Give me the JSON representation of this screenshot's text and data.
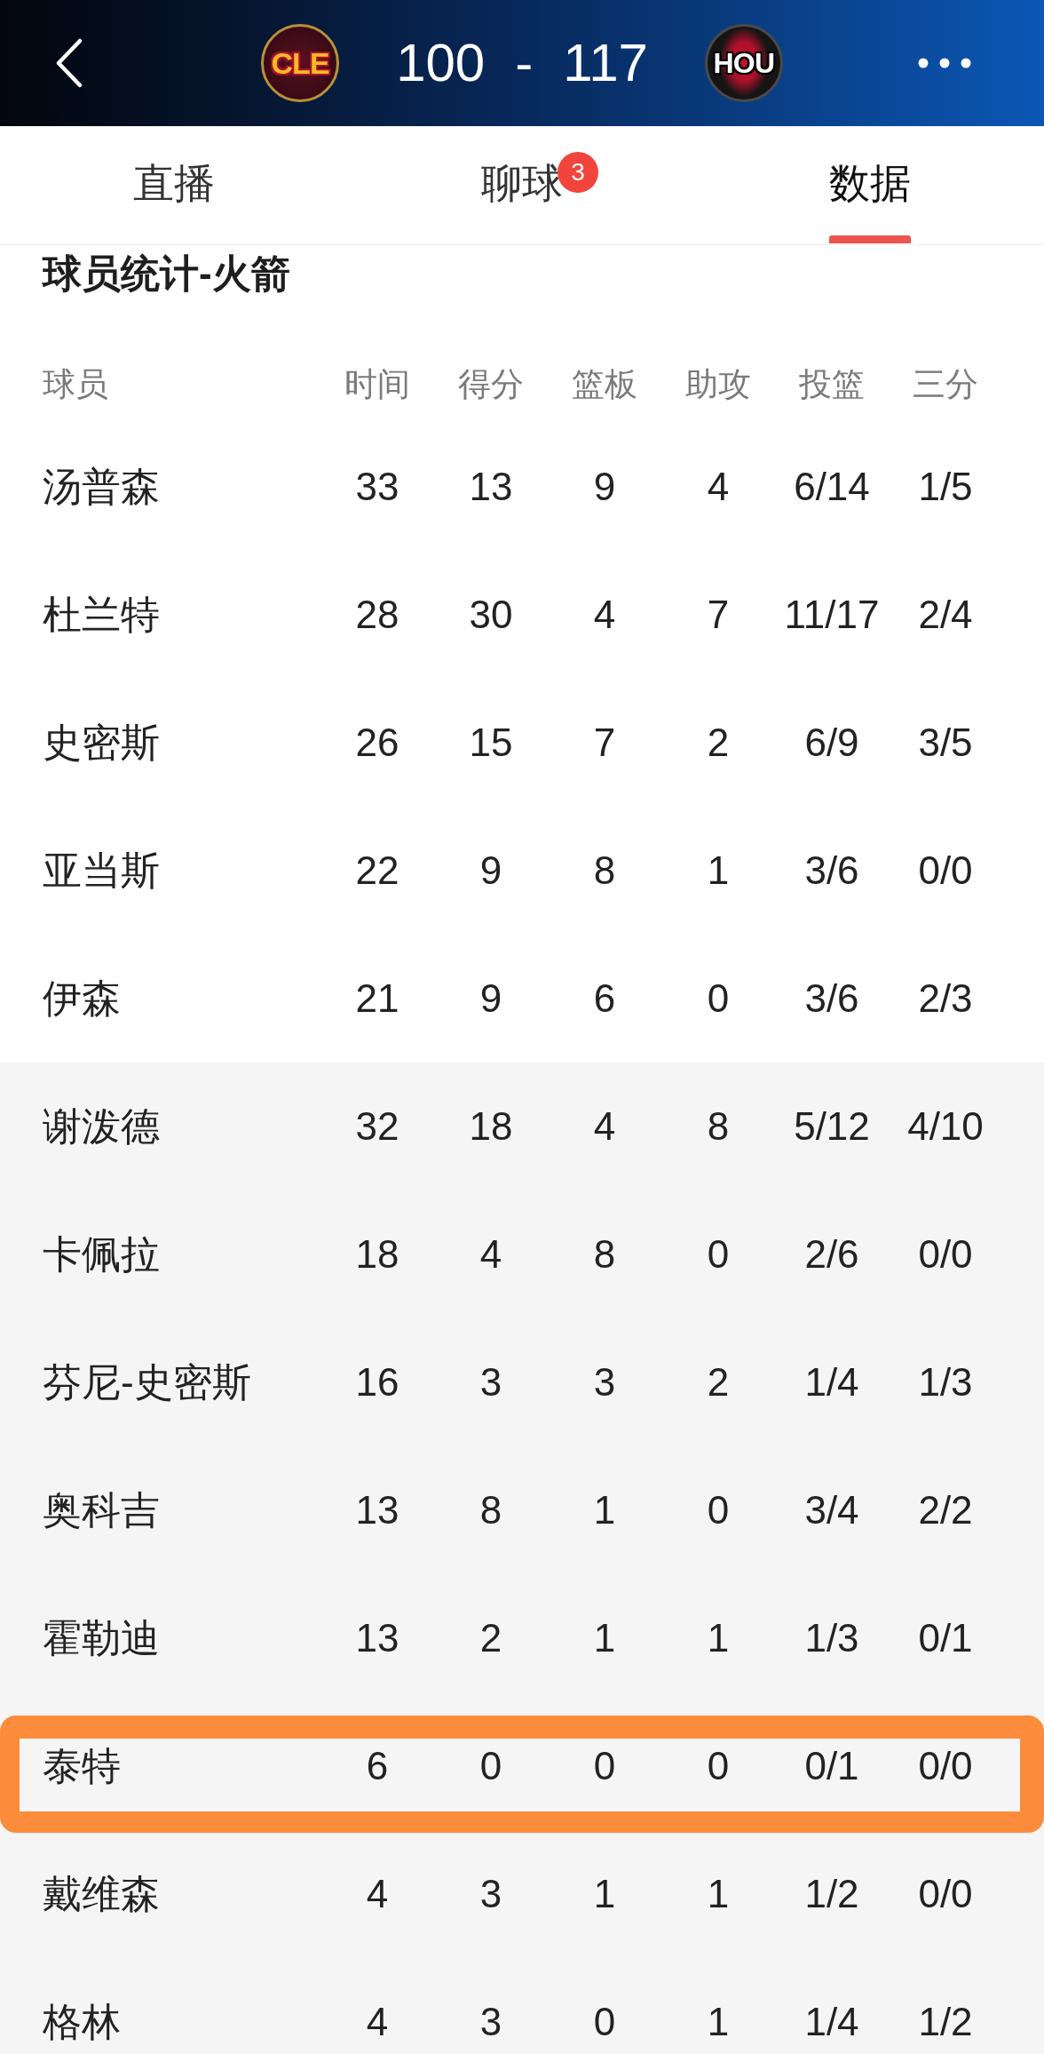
{
  "scoreboard": {
    "home_team": {
      "logo_text": "CLE"
    },
    "home_score": "100",
    "separator": "-",
    "away_score": "117",
    "away_team": {
      "logo_text": "HOU"
    }
  },
  "tabs": [
    {
      "label": "直播",
      "selected": false
    },
    {
      "label": "聊球",
      "selected": false,
      "badge": "3"
    },
    {
      "label": "数据",
      "selected": true
    }
  ],
  "stats": {
    "title": "球员统计-火箭",
    "columns": [
      "球员",
      "时间",
      "得分",
      "篮板",
      "助攻",
      "投篮",
      "三分"
    ],
    "rows": [
      {
        "kind": "starter",
        "name": "汤普森",
        "values": [
          "33",
          "13",
          "9",
          "4",
          "6/14",
          "1/5"
        ],
        "highlighted": false
      },
      {
        "kind": "starter",
        "name": "杜兰特",
        "values": [
          "28",
          "30",
          "4",
          "7",
          "11/17",
          "2/4"
        ],
        "highlighted": false
      },
      {
        "kind": "starter",
        "name": "史密斯",
        "values": [
          "26",
          "15",
          "7",
          "2",
          "6/9",
          "3/5"
        ],
        "highlighted": false
      },
      {
        "kind": "starter",
        "name": "亚当斯",
        "values": [
          "22",
          "9",
          "8",
          "1",
          "3/6",
          "0/0"
        ],
        "highlighted": false
      },
      {
        "kind": "starter",
        "name": "伊森",
        "values": [
          "21",
          "9",
          "6",
          "0",
          "3/6",
          "2/3"
        ],
        "highlighted": false
      },
      {
        "kind": "bench",
        "name": "谢泼德",
        "values": [
          "32",
          "18",
          "4",
          "8",
          "5/12",
          "4/10"
        ],
        "highlighted": false
      },
      {
        "kind": "bench",
        "name": "卡佩拉",
        "values": [
          "18",
          "4",
          "8",
          "0",
          "2/6",
          "0/0"
        ],
        "highlighted": false
      },
      {
        "kind": "bench",
        "name": "芬尼-史密斯",
        "values": [
          "16",
          "3",
          "3",
          "2",
          "1/4",
          "1/3"
        ],
        "highlighted": false
      },
      {
        "kind": "bench",
        "name": "奥科吉",
        "values": [
          "13",
          "8",
          "1",
          "0",
          "3/4",
          "2/2"
        ],
        "highlighted": false
      },
      {
        "kind": "bench",
        "name": "霍勒迪",
        "values": [
          "13",
          "2",
          "1",
          "1",
          "1/3",
          "0/1"
        ],
        "highlighted": false
      },
      {
        "kind": "bench",
        "name": "泰特",
        "values": [
          "6",
          "0",
          "0",
          "0",
          "0/1",
          "0/0"
        ],
        "highlighted": true
      },
      {
        "kind": "bench",
        "name": "戴维森",
        "values": [
          "4",
          "3",
          "1",
          "1",
          "1/2",
          "0/0"
        ],
        "highlighted": false
      },
      {
        "kind": "bench",
        "name": "格林",
        "values": [
          "4",
          "3",
          "0",
          "1",
          "1/4",
          "1/2"
        ],
        "highlighted": false
      }
    ]
  }
}
